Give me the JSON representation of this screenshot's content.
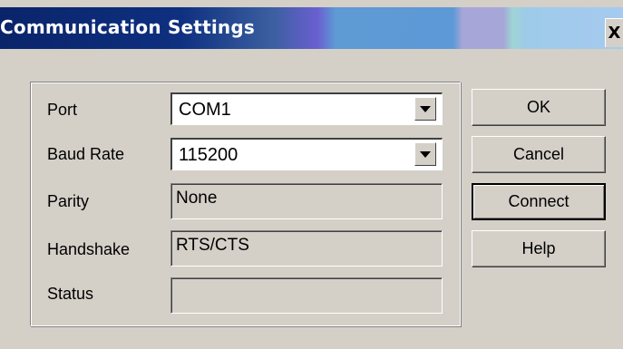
{
  "window": {
    "title": "Communication Settings",
    "close_label": "X"
  },
  "form": {
    "port": {
      "label": "Port",
      "value": "COM1"
    },
    "baud_rate": {
      "label": "Baud Rate",
      "value": "115200"
    },
    "parity": {
      "label": "Parity",
      "value": "None"
    },
    "handshake": {
      "label": "Handshake",
      "value": "RTS/CTS"
    },
    "status": {
      "label": "Status",
      "value": ""
    }
  },
  "buttons": {
    "ok": "OK",
    "cancel": "Cancel",
    "connect": "Connect",
    "help": "Help"
  }
}
